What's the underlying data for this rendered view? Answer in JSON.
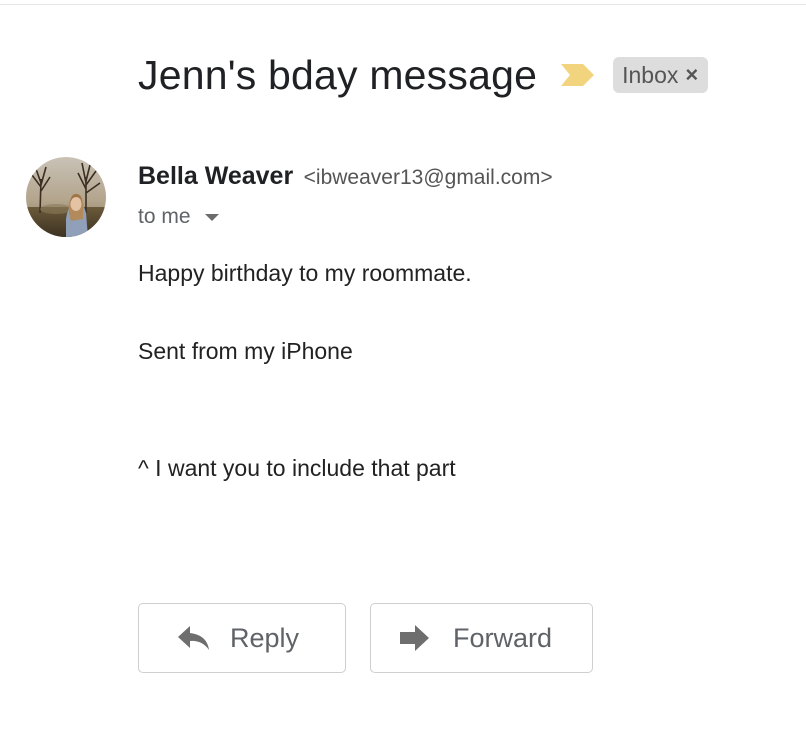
{
  "subject": {
    "title": "Jenn's bday message",
    "importance_icon": "importance-marker-icon",
    "importance_color": "#f2c94c",
    "label_chip": {
      "label": "Inbox",
      "close_glyph": "×",
      "background": "#dddddd"
    }
  },
  "message": {
    "sender_name": "Bella Weaver",
    "sender_email": "<ibweaver13@gmail.com>",
    "recipients": "to me",
    "avatar_icon": "sender-avatar-photo",
    "body": [
      "Happy birthday to my roommate.",
      "Sent from my iPhone",
      "^ I want you to include that part"
    ]
  },
  "actions": {
    "reply_label": "Reply",
    "reply_icon": "reply-arrow-icon",
    "forward_label": "Forward",
    "forward_icon": "forward-arrow-icon",
    "icon_color": "#6e6e6e",
    "border_color": "#cfcfcf"
  }
}
